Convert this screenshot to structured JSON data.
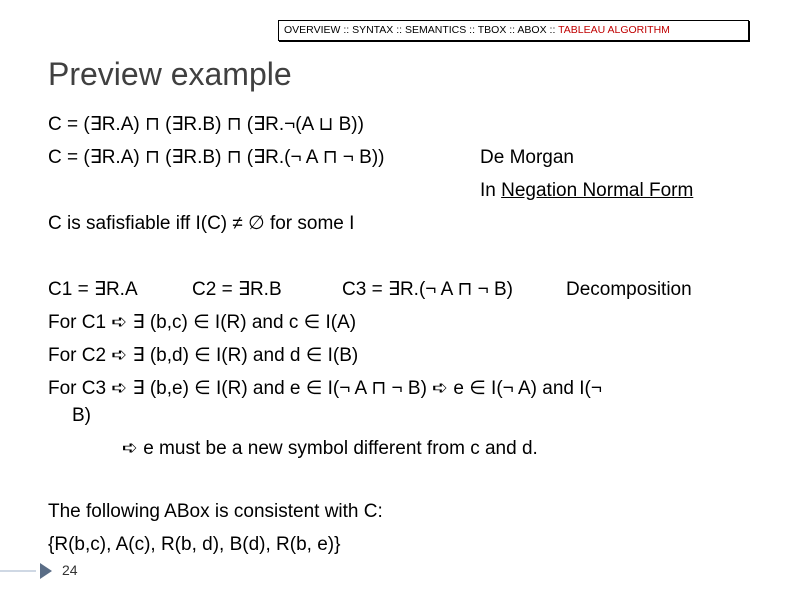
{
  "nav": {
    "items": [
      "OVERVIEW",
      "SYNTAX",
      "SEMANTICS",
      "TBOX",
      "ABOX",
      "TABLEAU ALGORITHM"
    ],
    "separator": " :: ",
    "active_index": 5,
    "active_color": "#c00000"
  },
  "title": "Preview example",
  "lines": {
    "l1": "C = (∃R.A) ⊓ (∃R.B) ⊓ (∃R.¬(A ⊔ B))",
    "l2": "C = (∃R.A) ⊓ (∃R.B) ⊓ (∃R.(¬ A ⊓ ¬ B))",
    "l2_note": "De Morgan",
    "l3_prefix": "In ",
    "l3_underlined": "Negation Normal Form",
    "l4": "C is safisfiable iff I(C) ≠ ∅ for some I",
    "l5_c1": "C1 = ∃R.A",
    "l5_c2": "C2 = ∃R.B",
    "l5_c3": "C3 = ∃R.(¬ A ⊓ ¬ B)",
    "l5_note": "Decomposition",
    "l6": "For C1 ➪ ∃ (b,c) ∈ I(R) and c ∈ I(A)",
    "l7": "For C2 ➪ ∃ (b,d) ∈ I(R) and d ∈ I(B)",
    "l8": "For C3 ➪ ∃ (b,e) ∈ I(R) and e ∈ I(¬ A ⊓ ¬ B) ➪ e ∈ I(¬ A) and I(¬",
    "l9": "B)",
    "l10": "➪ e must be a new symbol different from c and d.",
    "l11": "The following ABox is consistent with C:",
    "l12": "{R(b,c), A(c), R(b, d), B(d), R(b, e)}"
  },
  "footer": {
    "page_number": "24",
    "accent_color": "#5a6d86"
  }
}
